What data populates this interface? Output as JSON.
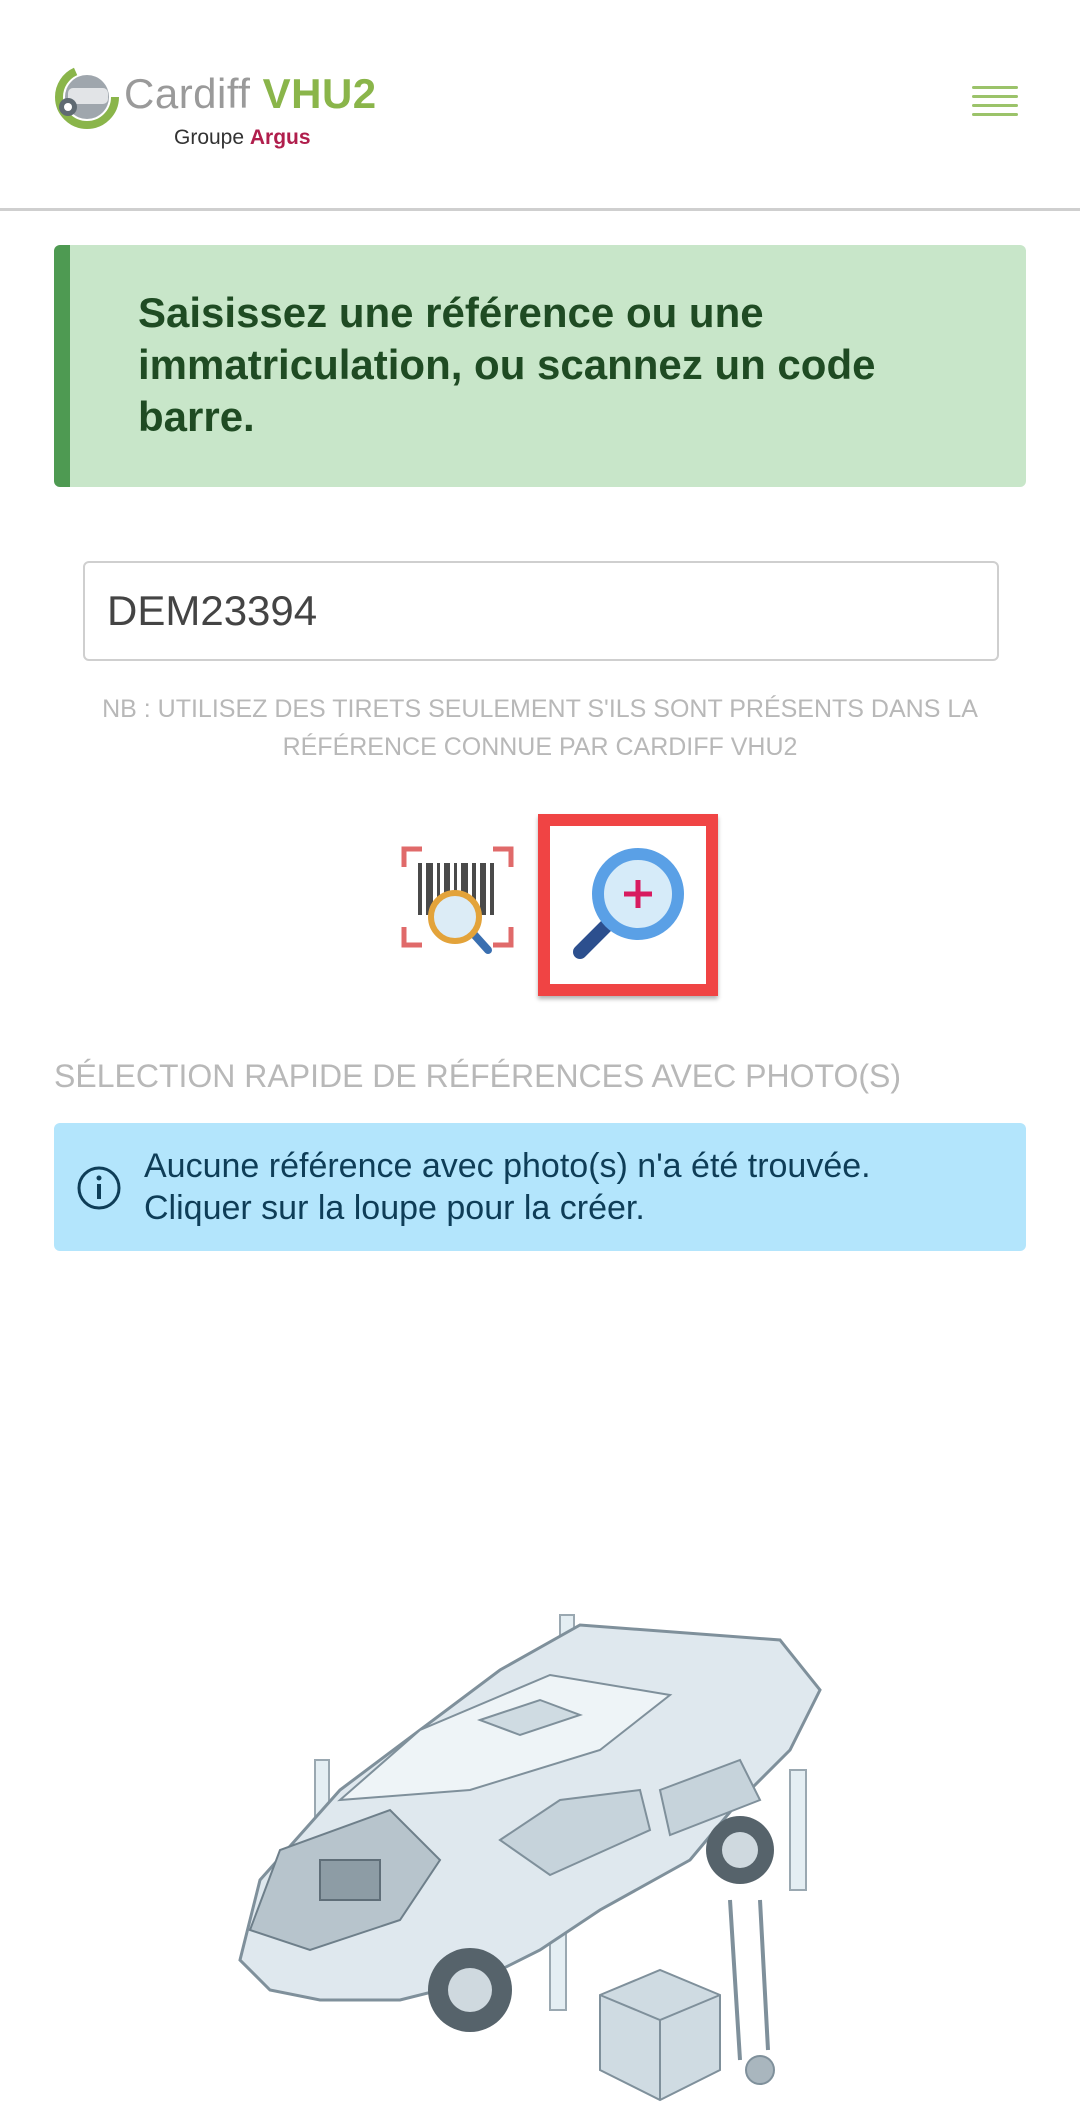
{
  "header": {
    "logo_brand": "Cardiff",
    "logo_product": "VHU2",
    "logo_group_prefix": "Groupe",
    "logo_group_name": "Argus",
    "menu_icon": "hamburger-icon"
  },
  "banner": {
    "text": "Saisissez une référence ou une immatriculation, ou scannez un code barre."
  },
  "search": {
    "value": "DEM23394",
    "hint": "NB : UTILISEZ DES TIRETS SEULEMENT S'ILS SONT PRÉSENTS DANS LA RÉFÉRENCE CONNUE PAR CARDIFF VHU2"
  },
  "actions": {
    "scan_icon": "barcode-scan-icon",
    "search_icon": "magnifier-plus-icon"
  },
  "quick_select": {
    "title": "SÉLECTION RAPIDE DE RÉFÉRENCES AVEC PHOTO(S)",
    "info_line1": "Aucune référence avec photo(s) n'a été trouvée.",
    "info_line2": "Cliquer sur la loupe pour la créer."
  },
  "colors": {
    "accent_green": "#8ab54a",
    "argus_red": "#b01e4c",
    "banner_bg": "#c8e6c9",
    "info_bg": "#b3e5fc",
    "highlight": "#f04444"
  }
}
